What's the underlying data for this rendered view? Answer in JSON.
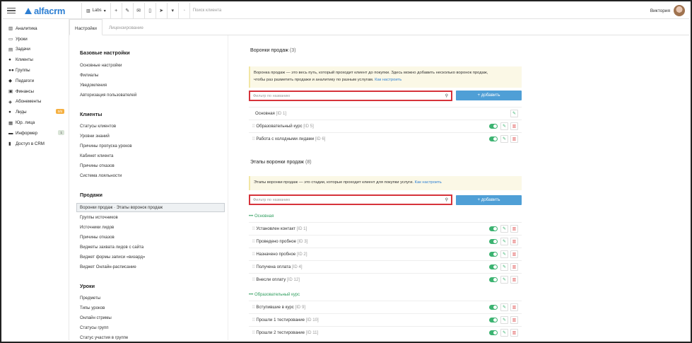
{
  "topbar": {
    "logo": "alfacrm",
    "branch": "Labs",
    "search_placeholder": "Поиск клиента",
    "user_name": "Виктория",
    "icons": [
      "plus-icon",
      "wrench-icon",
      "mail-icon",
      "phone-icon",
      "telegram-icon",
      "cart-icon",
      "bell-icon"
    ]
  },
  "sidebar": {
    "items": [
      {
        "label": "Аналитика",
        "icon": "chart-icon",
        "glyph": "▥"
      },
      {
        "label": "Уроки",
        "icon": "calendar-icon",
        "glyph": "▭"
      },
      {
        "label": "Задачи",
        "icon": "tasks-icon",
        "glyph": "▤"
      },
      {
        "label": "Клиенты",
        "icon": "user-icon",
        "glyph": "●"
      },
      {
        "label": "Группы",
        "icon": "users-icon",
        "glyph": "●●"
      },
      {
        "label": "Педагоги",
        "icon": "teacher-icon",
        "glyph": "◆"
      },
      {
        "label": "Финансы",
        "icon": "money-icon",
        "glyph": "▣"
      },
      {
        "label": "Абонементы",
        "icon": "tag-icon",
        "glyph": "◈"
      },
      {
        "label": "Лиды",
        "icon": "leads-icon",
        "glyph": "●",
        "badge": "0/5"
      },
      {
        "label": "Юр. лица",
        "icon": "building-icon",
        "glyph": "▦"
      },
      {
        "label": "Информер",
        "icon": "informer-icon",
        "glyph": "▬",
        "badge": "1"
      },
      {
        "label": "Доступ в CRM",
        "icon": "lock-icon",
        "glyph": "▮"
      }
    ]
  },
  "tabs": {
    "active": "Настройки",
    "inactive": "Лицензирование"
  },
  "nav": {
    "base_h": "Базовые настройки",
    "base": [
      "Основные настройки",
      "Филиалы",
      "Уведомления",
      "Авторизация пользователей"
    ],
    "clients_h": "Клиенты",
    "clients": [
      "Статусы клиентов",
      "Уровни знаний",
      "Причины пропуска уроков",
      "Кабинет клиента",
      "Причины отказов",
      "Система лояльности"
    ],
    "sales_h": "Продажи",
    "sales": [
      "Воронки продаж · Этапы воронок продаж",
      "Группы источников",
      "Источники лидов",
      "Причины отказов",
      "Виджеты захвата лидов с сайта",
      "Виджет формы записи «визард»",
      "Виджет Онлайн-расписание"
    ],
    "lessons_h": "Уроки",
    "lessons": [
      "Предметы",
      "Типы уроков",
      "Онлайн стримы",
      "Статусы групп",
      "Статус участия в группе"
    ]
  },
  "funnels": {
    "title": "Воронки продаж",
    "count": "(3)",
    "note1": "Воронка продаж — это весь путь, который проходит клиент до покупки. Здесь можно добавить несколько воронок продаж,",
    "note2": "чтобы раз разметить продажи и аналитику по разным услугам.",
    "link": "Как настроить",
    "filter_placeholder": "Фильтр по названию",
    "add": "+ добавить",
    "rows": [
      {
        "name": "Основная",
        "id": "[ID 1]"
      },
      {
        "name": "Образовательный курс",
        "id": "[ID 5]"
      },
      {
        "name": "Работа с холодными лидами",
        "id": "[ID 6]"
      }
    ]
  },
  "stages": {
    "title": "Этапы воронки продаж",
    "count": "(8)",
    "note": "Этапы воронки продаж — это стадии, которые проходит клиент для покупки услуги.",
    "link": "Как настроить",
    "filter_placeholder": "Фильтр по названию",
    "add": "+ добавить",
    "group1": "••• Основная",
    "group1_rows": [
      {
        "name": "Установлен контакт",
        "id": "[ID 1]"
      },
      {
        "name": "Проведено пробное",
        "id": "[ID 3]"
      },
      {
        "name": "Назначено пробное",
        "id": "[ID 2]"
      },
      {
        "name": "Получена оплата",
        "id": "[ID 4]"
      },
      {
        "name": "Внесли оплату",
        "id": "[ID 12]"
      }
    ],
    "group2": "••• Образовательный курс",
    "group2_rows": [
      {
        "name": "Вступившие в курс",
        "id": "[ID 9]"
      },
      {
        "name": "Прошли 1 тестирование",
        "id": "[ID 10]"
      },
      {
        "name": "Прошли 2 тестирование",
        "id": "[ID 11]"
      }
    ]
  }
}
